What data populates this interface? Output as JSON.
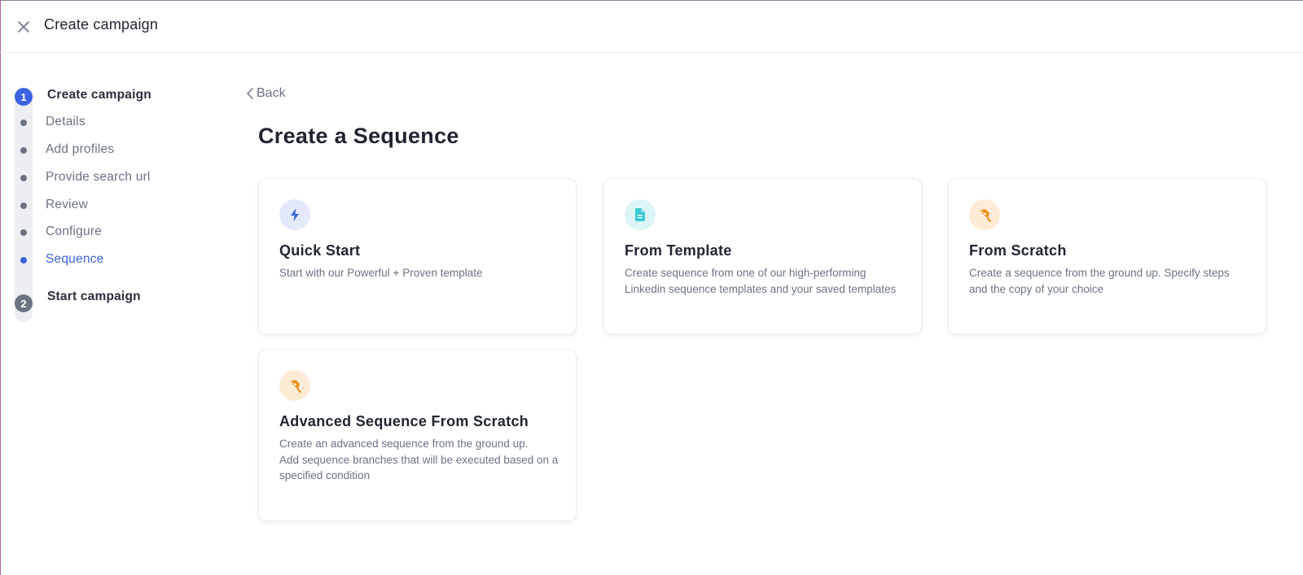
{
  "header": {
    "title": "Create campaign"
  },
  "stepper": {
    "step1": {
      "number": "1",
      "title": "Create campaign"
    },
    "substeps": [
      {
        "label": "Details"
      },
      {
        "label": "Add profiles"
      },
      {
        "label": "Provide search url"
      },
      {
        "label": "Review"
      },
      {
        "label": "Configure"
      },
      {
        "label": "Sequence"
      }
    ],
    "step2": {
      "number": "2",
      "title": "Start campaign"
    }
  },
  "main": {
    "back_label": "Back",
    "title": "Create a Sequence",
    "cards": [
      {
        "title": "Quick Start",
        "description": [
          "Start with our Powerful + Proven template"
        ],
        "icon": "lightning-icon",
        "icon_color": "#3b63e0"
      },
      {
        "title": "From Template",
        "description": [
          "Create sequence from one of our high-performing Linkedin sequence templates and your saved templates"
        ],
        "icon": "document-icon",
        "icon_color": "#3cc8d2"
      },
      {
        "title": "From Scratch",
        "description": [
          "Create a sequence from the ground up. Specify steps and the copy of your choice"
        ],
        "icon": "pen-nib-icon",
        "icon_color": "#e8901c"
      },
      {
        "title": "Advanced Sequence From Scratch",
        "description": [
          "Create an advanced sequence from the ground up.",
          "Add sequence branches that will be executed based on a specified condition"
        ],
        "icon": "pen-nib-icon",
        "icon_color": "#e8901c"
      }
    ]
  },
  "colors": {
    "accent": "#3b63e0",
    "muted_text": "#6b7383",
    "inactive_step": "#6b7383"
  }
}
